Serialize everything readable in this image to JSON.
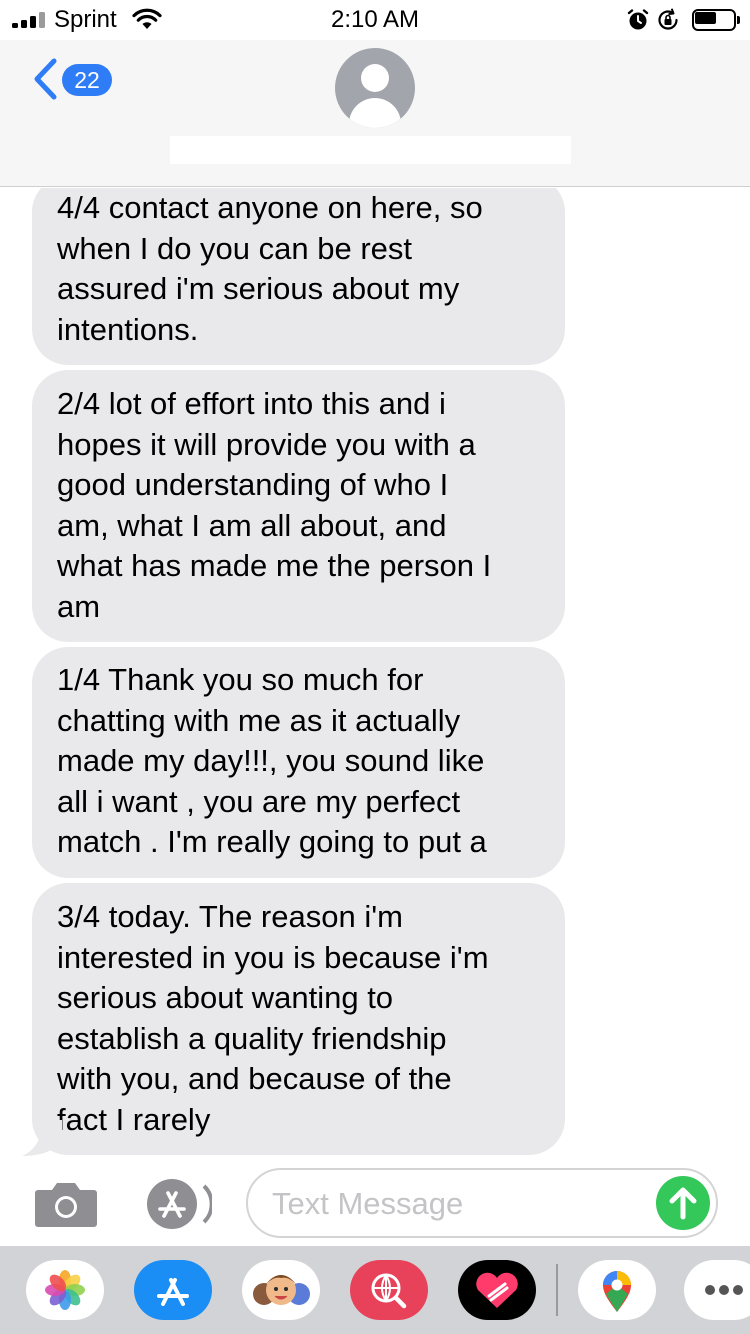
{
  "status_bar": {
    "carrier": "Sprint",
    "time": "2:10 AM",
    "signal_bars_filled": 3,
    "signal_bars_total": 4,
    "battery_level": 0.55
  },
  "header": {
    "unread_count": "22",
    "back_icon": "chevron-left-icon",
    "avatar_icon": "person-silhouette-icon",
    "contact_name": ""
  },
  "messages": [
    {
      "direction": "incoming",
      "text": "4/4  contact anyone on here, so\nwhen I do you can be rest\nassured i'm serious about my\nintentions."
    },
    {
      "direction": "incoming",
      "text": "2/4 lot of effort into this and i\nhopes it will provide you with a\ngood understanding of who I\nam, what I am all about, and\nwhat has made me the person I\nam"
    },
    {
      "direction": "incoming",
      "text": "1/4 Thank you so much for\nchatting with me as it actually\nmade my day!!!, you sound like\nall i want , you are my perfect\nmatch . I'm really going to put a"
    },
    {
      "direction": "incoming",
      "text": "3/4 today. The reason i'm\ninterested in you is because i'm\nserious about wanting to\nestablish a quality friendship\nwith you, and because of the\nfact I rarely"
    }
  ],
  "input_bar": {
    "placeholder": "Text Message",
    "value": "",
    "camera_icon": "camera-icon",
    "apps_icon": "app-store-icon",
    "send_icon": "arrow-up-icon"
  },
  "app_drawer": {
    "apps": [
      {
        "name": "Photos",
        "icon": "photos-icon"
      },
      {
        "name": "App Store",
        "icon": "app-store-icon"
      },
      {
        "name": "Memoji",
        "icon": "memoji-icon"
      },
      {
        "name": "Search",
        "icon": "globe-search-icon"
      },
      {
        "name": "Digital Touch",
        "icon": "heart-icon"
      },
      {
        "name": "Google Maps",
        "icon": "map-pin-icon"
      },
      {
        "name": "More",
        "icon": "more-icon"
      }
    ]
  },
  "colors": {
    "accent_blue": "#2f7df6",
    "incoming_bubble": "#e9e9eb",
    "send_green": "#34c759",
    "header_bg": "#f6f6f6",
    "drawer_bg": "#d2d3d6"
  }
}
